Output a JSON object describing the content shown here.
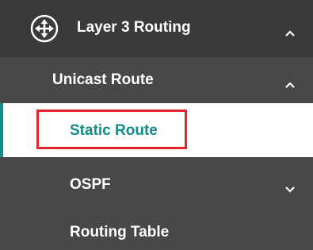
{
  "menu": {
    "layer3": {
      "label": "Layer 3 Routing",
      "icon": "routing-icon",
      "expanded": true
    },
    "unicast": {
      "label": "Unicast Route",
      "expanded": true
    },
    "static_route": {
      "label": "Static Route",
      "selected": true
    },
    "ospf": {
      "label": "OSPF",
      "expanded": false
    },
    "routing_table": {
      "label": "Routing Table"
    }
  },
  "colors": {
    "top_bg": "#3a3a3a",
    "item_bg": "#484848",
    "accent": "#0e8d8a",
    "highlight": "#e0262b"
  }
}
